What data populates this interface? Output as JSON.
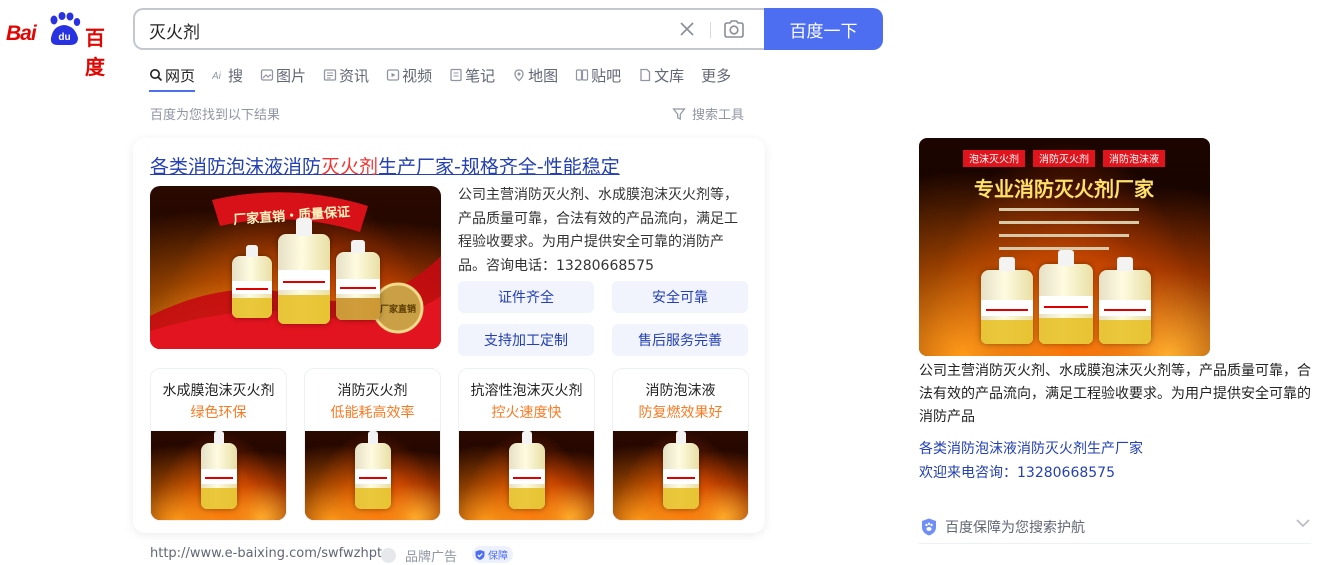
{
  "logo": {
    "left_text": "Bai",
    "paw_text": "du",
    "right_text": "百度"
  },
  "search": {
    "query": "灭火剂",
    "button": "百度一下"
  },
  "tabs": [
    {
      "label": "网页",
      "icon": "search-icon"
    },
    {
      "label": "搜",
      "icon": "ai-icon"
    },
    {
      "label": "图片",
      "icon": "image-icon"
    },
    {
      "label": "资讯",
      "icon": "news-icon"
    },
    {
      "label": "视频",
      "icon": "video-icon"
    },
    {
      "label": "笔记",
      "icon": "note-icon"
    },
    {
      "label": "地图",
      "icon": "map-icon"
    },
    {
      "label": "贴吧",
      "icon": "tieba-icon"
    },
    {
      "label": "文库",
      "icon": "doc-icon"
    },
    {
      "label": "更多"
    }
  ],
  "result_count": "百度为您找到以下结果",
  "search_tools": "搜索工具",
  "ad": {
    "title_pre": "各类消防泡沫液消防",
    "title_hl": "灭火剂",
    "title_post": "生产厂家-规格齐全-性能稳定",
    "desc": "公司主营消防灭火剂、水成膜泡沫灭火剂等，产品质量可靠，合法有效的产品流向，满足工程验收要求。为用户提供安全可靠的消防产品。咨询电话：13280668575",
    "image_banner": "厂家直销・质量保证",
    "image_seal": "厂家直销",
    "pills": [
      "证件齐全",
      "安全可靠",
      "支持加工定制",
      "售后服务完善"
    ],
    "subs": [
      {
        "title": "水成膜泡沫灭火剂",
        "tag": "绿色环保"
      },
      {
        "title": "消防灭火剂",
        "tag": "低能耗高效率"
      },
      {
        "title": "抗溶性泡沫灭火剂",
        "tag": "控火速度快"
      },
      {
        "title": "消防泡沫液",
        "tag": "防复燃效果好"
      }
    ],
    "url": "http://www.e-baixing.com/swfwzhpt",
    "brand": "品牌广告",
    "guarantee": "保障"
  },
  "right": {
    "img_tags": [
      "泡沫灭火剂",
      "消防灭火剂",
      "消防泡沫液"
    ],
    "img_title": "专业消防灭火剂厂家",
    "desc": "公司主营消防灭火剂、水成膜泡沫灭火剂等，产品质量可靠，合法有效的产品流向，满足工程验收要求。为用户提供安全可靠的消防产品",
    "link": "各类消防泡沫液消防灭火剂生产厂家",
    "tel": "欢迎来电咨询：13280668575",
    "protect": "百度保障为您搜索护航"
  },
  "colors": {
    "brand_red": "#e10601",
    "accent_blue": "#4e6ef2",
    "link_blue": "#2440b3",
    "highlight_red": "#f73131",
    "tag_orange": "#fa7a23"
  }
}
